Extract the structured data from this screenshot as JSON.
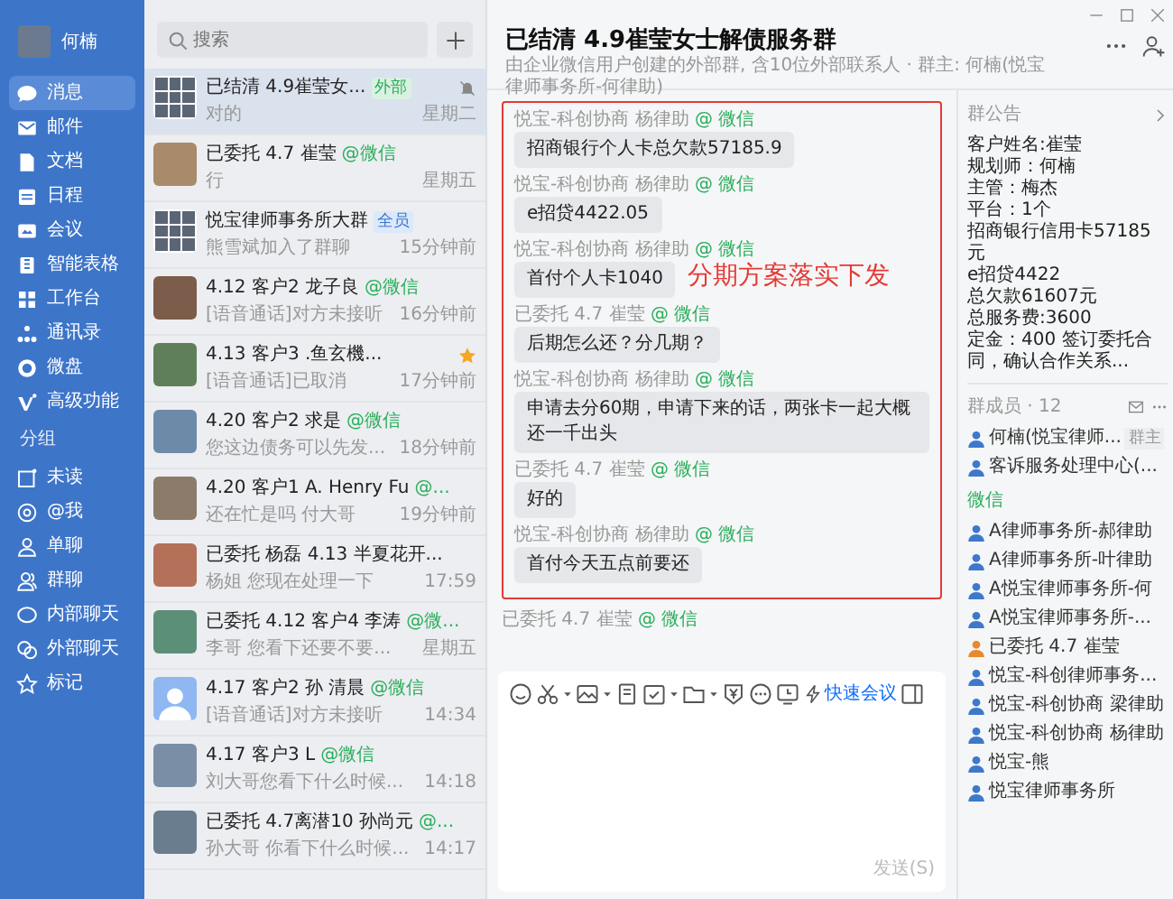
{
  "user": {
    "name": "何楠"
  },
  "nav": [
    {
      "label": "消息",
      "selected": true
    },
    {
      "label": "邮件",
      "selected": false
    },
    {
      "label": "文档",
      "selected": false
    },
    {
      "label": "日程",
      "selected": false
    },
    {
      "label": "会议",
      "selected": false
    },
    {
      "label": "智能表格",
      "selected": false
    },
    {
      "label": "工作台",
      "selected": false
    },
    {
      "label": "通讯录",
      "selected": false
    },
    {
      "label": "微盘",
      "selected": false
    },
    {
      "label": "高级功能",
      "selected": false
    }
  ],
  "group_heading": "分组",
  "filters": [
    {
      "label": "未读",
      "selected": false
    },
    {
      "label": "@我",
      "selected": false
    },
    {
      "label": "单聊",
      "selected": false
    },
    {
      "label": "群聊",
      "selected": false
    },
    {
      "label": "内部聊天",
      "selected": false
    },
    {
      "label": "外部聊天",
      "selected": false
    },
    {
      "label": "标记",
      "selected": false
    }
  ],
  "chat_list": {
    "search_placeholder": "搜索",
    "items": [
      {
        "kind": "group",
        "title": "已结清 4.9崔莹女...",
        "badge": "外部",
        "preview": "对的",
        "time": "星期二",
        "selected": true,
        "muted": true,
        "starred": false
      },
      {
        "kind": "photo",
        "title": "已委托 4.7 崔莹",
        "suffix": "@微信",
        "preview": "行",
        "time": "星期五",
        "selected": false,
        "muted": false,
        "starred": false
      },
      {
        "kind": "group",
        "title": "悦宝律师事务所大群",
        "badge": "全员",
        "preview": "熊雪斌加入了群聊",
        "time": "15分钟前",
        "selected": false,
        "muted": false,
        "starred": false
      },
      {
        "kind": "photo",
        "title": "4.12 客户2 龙子良",
        "suffix": "@微信",
        "preview": "[语音通话]对方未接听",
        "time": "16分钟前",
        "selected": false,
        "muted": false,
        "starred": false
      },
      {
        "kind": "photo",
        "title": "4.13 客户3 .鱼玄機...",
        "preview": "[语音通话]已取消",
        "time": "17分钟前",
        "selected": false,
        "muted": false,
        "starred": true
      },
      {
        "kind": "photo",
        "title": "4.20 客户2 求是",
        "suffix": "@微信",
        "preview": "您这边债务可以先发...",
        "time": "18分钟前",
        "selected": false,
        "muted": false,
        "starred": false
      },
      {
        "kind": "photo",
        "title": "4.20 客户1 A. Henry Fu",
        "suffix": "@...",
        "preview": "还在忙是吗 付大哥",
        "time": "19分钟前",
        "selected": false,
        "muted": false,
        "starred": false
      },
      {
        "kind": "photo",
        "title": "已委托 杨磊 4.13 半夏花开...",
        "preview": "杨姐 您现在处理一下",
        "time": "17:59",
        "selected": false,
        "muted": false,
        "starred": false
      },
      {
        "kind": "photo",
        "title": "已委托 4.12 客户4 李涛",
        "suffix": "@微...",
        "preview": "李哥 您看下还要不要...",
        "time": "星期五",
        "selected": false,
        "muted": false,
        "starred": false
      },
      {
        "kind": "default",
        "title": "4.17 客户2 孙 清晨",
        "suffix": "@微信",
        "preview": "[语音通话]对方未接听",
        "time": "14:34",
        "selected": false,
        "muted": false,
        "starred": false
      },
      {
        "kind": "photo",
        "title": "4.17 客户3 L",
        "suffix": "@微信",
        "preview": "刘大哥您看下什么时候...",
        "time": "14:18",
        "selected": false,
        "muted": false,
        "starred": false
      },
      {
        "kind": "photo",
        "title": "已委托 4.7离潜10 孙尚元",
        "suffix": "@...",
        "preview": "孙大哥 你看下什么时候...",
        "time": "14:17",
        "selected": false,
        "muted": false,
        "starred": false
      }
    ]
  },
  "chat": {
    "title": "已结清 4.9崔莹女士解债服务群",
    "subtitle": "由企业微信用户创建的外部群, 含10位外部联系人 · 群主: 何楠(悦宝律师事务所-何律助)",
    "annotation": "分期方案落实下发",
    "messages": [
      {
        "sender": "悦宝-科创协商 杨律助",
        "suffix": "@ 微信",
        "text": "招商银行个人卡总欠款57185.9"
      },
      {
        "sender": "悦宝-科创协商 杨律助",
        "suffix": "@ 微信",
        "text": "e招贷4422.05"
      },
      {
        "sender": "悦宝-科创协商 杨律助",
        "suffix": "@ 微信",
        "text": "首付个人卡1040"
      },
      {
        "sender": "已委托 4.7 崔莹",
        "suffix": "@ 微信",
        "text": "后期怎么还？分几期？"
      },
      {
        "sender": "悦宝-科创协商 杨律助",
        "suffix": "@ 微信",
        "text": "申请去分60期，申请下来的话，两张卡一起大概还一千出头"
      },
      {
        "sender": "已委托 4.7 崔莹",
        "suffix": "@ 微信",
        "text": "好的"
      },
      {
        "sender": "悦宝-科创协商 杨律助",
        "suffix": "@ 微信",
        "text": "首付今天五点前要还"
      }
    ],
    "trailing_sender": {
      "sender": "已委托 4.7 崔莹",
      "suffix": "@ 微信"
    },
    "quick_meeting": "快速会议",
    "send_button": "发送(S)"
  },
  "side_panel": {
    "notice_title": "群公告",
    "notice_lines": [
      "客户姓名:崔莹",
      "规划师：何楠",
      "主管：梅杰",
      "平台：1个",
      "招商银行信用卡57185元",
      "e招贷4422",
      "总欠款61607元",
      "总服务费:3600",
      "定金：400 签订委托合同，确认合作关系..."
    ],
    "members_title": "群成员 · 12",
    "members": [
      {
        "kind": "member",
        "name": "何楠(悦宝律师...",
        "badge": "群主",
        "color": "#3d78cc"
      },
      {
        "kind": "member",
        "name": "客诉服务处理中心(...",
        "color": "#3d78cc"
      },
      {
        "kind": "heading",
        "name": "微信"
      },
      {
        "kind": "member",
        "name": "A律师事务所-郝律助",
        "color": "#3d78cc"
      },
      {
        "kind": "member",
        "name": "A律师事务所-叶律助",
        "color": "#3d78cc"
      },
      {
        "kind": "member",
        "name": "A悦宝律师事务所-何",
        "color": "#3d78cc"
      },
      {
        "kind": "member",
        "name": "A悦宝律师事务所-...",
        "color": "#3d78cc"
      },
      {
        "kind": "member",
        "name": "已委托 4.7 崔莹",
        "color": "#e8892c"
      },
      {
        "kind": "member",
        "name": "悦宝-科创律师事务...",
        "color": "#3d78cc"
      },
      {
        "kind": "member",
        "name": "悦宝-科创协商 梁律助",
        "color": "#3d78cc"
      },
      {
        "kind": "member",
        "name": "悦宝-科创协商 杨律助",
        "color": "#3d78cc"
      },
      {
        "kind": "member",
        "name": "悦宝-熊",
        "color": "#3d78cc"
      },
      {
        "kind": "member",
        "name": "悦宝律师事务所",
        "color": "#3d78cc"
      }
    ]
  }
}
